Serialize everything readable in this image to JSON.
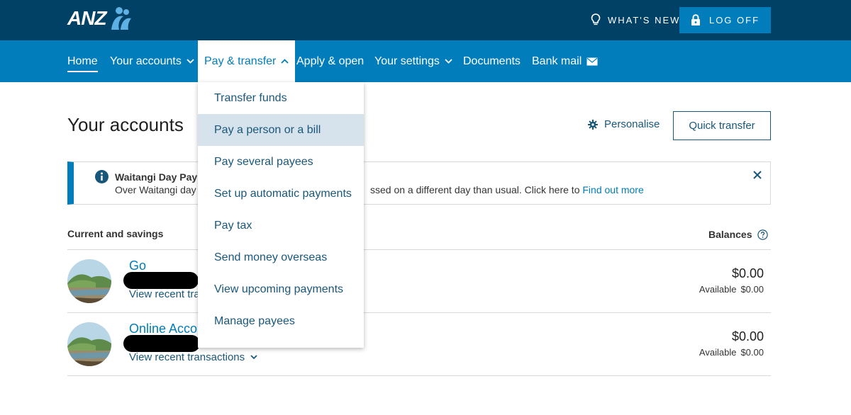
{
  "header": {
    "logo_text": "ANZ",
    "whats_new_label": "WHAT'S NEW",
    "logoff_label": "LOG OFF"
  },
  "nav": {
    "items": [
      {
        "label": "Home"
      },
      {
        "label": "Your accounts"
      },
      {
        "label": "Pay & transfer"
      },
      {
        "label": "Apply & open"
      },
      {
        "label": "Your settings"
      },
      {
        "label": "Documents"
      },
      {
        "label": "Bank mail"
      }
    ],
    "active": "Home",
    "open_menu": "Pay & transfer"
  },
  "pay_menu": {
    "items": [
      {
        "label": "Transfer funds"
      },
      {
        "label": "Pay a person or a bill"
      },
      {
        "label": "Pay several payees"
      },
      {
        "label": "Set up automatic payments"
      },
      {
        "label": "Pay tax"
      },
      {
        "label": "Send money overseas"
      },
      {
        "label": "View upcoming payments"
      },
      {
        "label": "Manage payees"
      }
    ],
    "highlighted": "Pay a person or a bill"
  },
  "main": {
    "title": "Your accounts",
    "personalise_label": "Personalise",
    "quick_transfer_label": "Quick transfer"
  },
  "alert": {
    "title_visible": "Waitangi Day Paym",
    "body_left_visible": "Over Waitangi day w",
    "body_right_visible": "ssed on a different day than usual. Click here to ",
    "link_text": "Find out more"
  },
  "accounts_section": {
    "title": "Current and savings",
    "balances_label": "Balances",
    "accounts": [
      {
        "name_visible": "Go",
        "recent_label_visible": "View recent tra",
        "balance": "$0.00",
        "available_label": "Available",
        "available_value": "$0.00"
      },
      {
        "name_visible": "Online Accou",
        "recent_label_visible": "View recent transactions",
        "balance": "$0.00",
        "available_label": "Available",
        "available_value": "$0.00"
      }
    ]
  },
  "colors": {
    "topbar": "#004165",
    "navbar": "#007dba",
    "link": "#007dba",
    "menu_text": "#19577a",
    "menu_highlight": "#d7e3ec"
  }
}
